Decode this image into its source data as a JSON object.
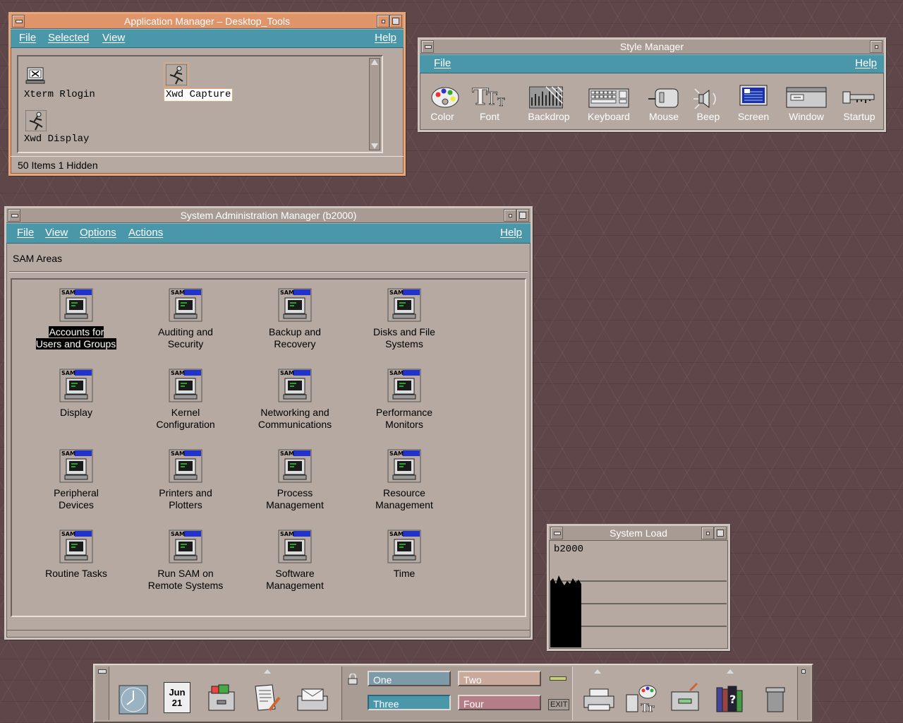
{
  "app_manager": {
    "title": "Application Manager – Desktop_Tools",
    "menu": [
      "File",
      "Selected",
      "View"
    ],
    "help": "Help",
    "icons": [
      {
        "label": "Xterm Rlogin",
        "icon": "terminal-icon"
      },
      {
        "label": "Xwd Capture",
        "icon": "runner-icon",
        "selected": true
      },
      {
        "label": "Xwd Display",
        "icon": "runner-icon"
      }
    ],
    "status": "50 Items 1 Hidden"
  },
  "style_manager": {
    "title": "Style Manager",
    "menu": [
      "File"
    ],
    "help": "Help",
    "tools": [
      "Color",
      "Font",
      "Backdrop",
      "Keyboard",
      "Mouse",
      "Beep",
      "Screen",
      "Window",
      "Startup"
    ]
  },
  "sam": {
    "title": "System Administration Manager (b2000)",
    "menu": [
      "File",
      "View",
      "Options",
      "Actions"
    ],
    "help": "Help",
    "areas_label": "SAM Areas",
    "badge": "SAM",
    "items": [
      [
        "Accounts for",
        "Users and Groups"
      ],
      [
        "Auditing and",
        "Security"
      ],
      [
        "Backup and",
        "Recovery"
      ],
      [
        "Disks and File",
        "Systems"
      ],
      [
        "Display",
        ""
      ],
      [
        "Kernel",
        "Configuration"
      ],
      [
        "Networking and",
        "Communications"
      ],
      [
        "Performance",
        "Monitors"
      ],
      [
        "Peripheral",
        "Devices"
      ],
      [
        "Printers and",
        "Plotters"
      ],
      [
        "Process",
        "Management"
      ],
      [
        "Resource",
        "Management"
      ],
      [
        "Routine Tasks",
        ""
      ],
      [
        "Run SAM on",
        "Remote Systems"
      ],
      [
        "Software",
        "Management"
      ],
      [
        "Time",
        ""
      ]
    ]
  },
  "system_load": {
    "title": "System Load",
    "host": "b2000"
  },
  "front_panel": {
    "date_month": "Jun",
    "date_day": "21",
    "workspaces": [
      "One",
      "Two",
      "Three",
      "Four"
    ],
    "exit": "EXIT",
    "colors": {
      "one": "#7c9aa8",
      "two": "#c9a99a",
      "three": "#4b97aa",
      "four": "#b57d86"
    }
  }
}
